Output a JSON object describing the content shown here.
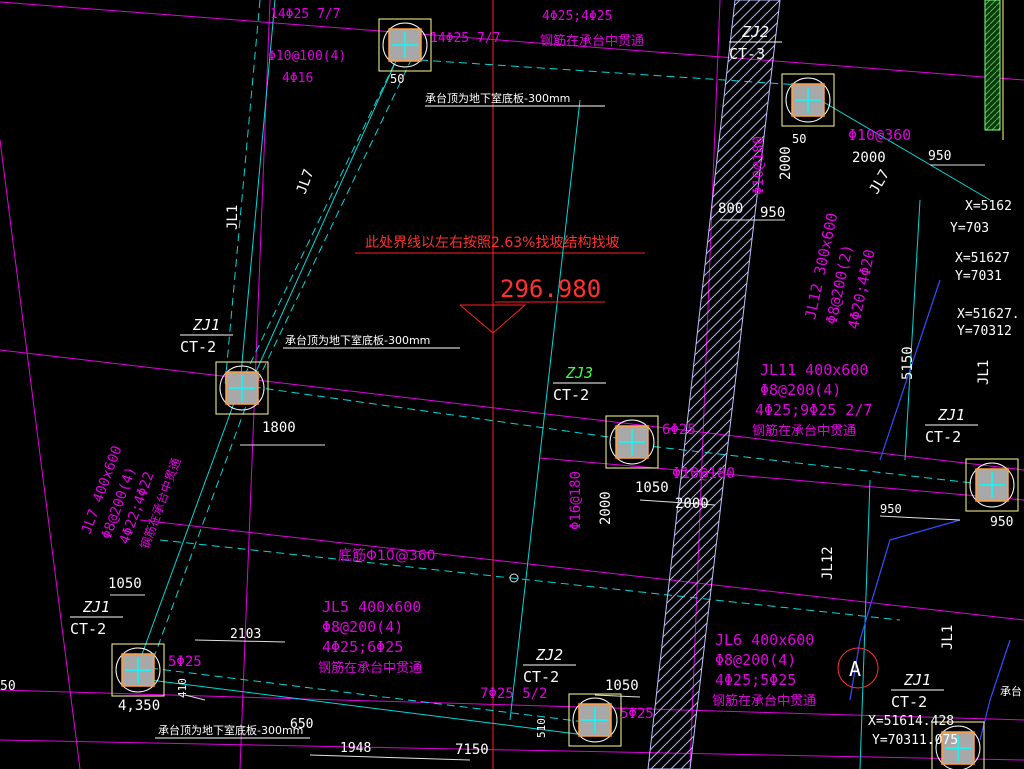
{
  "drawing": {
    "elevation_label": "296.980",
    "slope_note": "此处界线以左右按照2.63%找坡结构找坡",
    "base_rebar_note": "底筋Φ10@360",
    "piles": [
      {
        "id": "zj1_top_left_label",
        "line1": "ZJ1",
        "line2": "CT-2"
      },
      {
        "id": "zj1_bottom_left_label",
        "line1": "ZJ1",
        "line2": "CT-2"
      },
      {
        "id": "zj3_label",
        "line1": "ZJ3",
        "line2": "CT-2"
      },
      {
        "id": "zj2_bottom_label",
        "line1": "ZJ2",
        "line2": "CT-2"
      },
      {
        "id": "zj2_top_right_label",
        "line1": "ZJ2",
        "line2": "CT-3"
      },
      {
        "id": "zj1_right_label",
        "line1": "ZJ1",
        "line2": "CT-2"
      },
      {
        "id": "zj1_far_right_label",
        "line1": "ZJ1",
        "line2": "CT-2"
      },
      {
        "id": "zj1_bottom_right_label",
        "line1": "ZJ1",
        "line2": "CT-2"
      }
    ],
    "notes": {
      "slab_top_1": "承台顶为地下室底板-300mm",
      "slab_top_2": "承台顶为地下室底板-300mm",
      "slab_top_3": "承台顶为地下室底板-300mm",
      "jl5_1": "JL5 400x600",
      "jl5_2": "Φ8@200(4)",
      "jl5_3": "4Φ25;6Φ25",
      "jl5_4": "钢筋在承台中贯通",
      "jl6_1": "JL6 400x600",
      "jl6_2": "Φ8@200(4)",
      "jl6_3": "4Φ25;5Φ25",
      "jl6_4": "钢筋在承台中贯通",
      "jl11_1": "JL11 400x600",
      "jl11_2": "Φ8@200(4)",
      "jl11_3": "4Φ25;9Φ25 2/7",
      "jl11_4": "钢筋在承台中贯通",
      "jl12_1": "JL12 300x600",
      "jl12_2": "Φ8@200(2)",
      "jl12_3": "4Φ20;4Φ20",
      "jl7_1": "JL7 400x600",
      "jl7_2": "Φ8@200(4)",
      "jl7_3": "4Φ22;4Φ22",
      "jl7_4": "钢筋在承台中贯通",
      "top_1": "14Φ25 7/7",
      "top_2": "14Φ25 7/7",
      "top_3": "4Φ25;4Φ25",
      "top_4": "钢筋在承台中贯通",
      "top_5": "Φ10@100(4)",
      "top_6": "4Φ16",
      "rebar_360": "Φ10@360",
      "rebar_180a": "Φ10@180",
      "rebar_180b": "Φ10@180",
      "rebar_180c": "Φ16@180",
      "rebar_6_25": "6Φ25",
      "rebar_5_25a": "5Φ25",
      "rebar_5_25b": "5Φ25",
      "rebar_7_25": "7Φ25 5/2",
      "axis_A": "A",
      "jl1": "JL1",
      "jl7v": "JL7",
      "jl12v": "JL12",
      "jl1r": "JL1",
      "jl7r": "JL7",
      "jl1br": "JL1",
      "jl12b": "JL12",
      "coord_1x": "X=51627",
      "coord_1y": "Y=7031",
      "coord_2x": "X=51627.",
      "coord_2y": "Y=70312",
      "coord_3x": "X=5162",
      "coord_3y": "Y=703",
      "coord_4x": "X=51614.428",
      "coord_4y": "Y=70311.075",
      "chengtai": "承台",
      "d_50a": "50",
      "d_50b": "50",
      "d_1800": "1800",
      "d_1050a": "1050",
      "d_1050b": "1050",
      "d_1050c": "1050",
      "d_2103": "2103",
      "d_4350": "4,350",
      "d_1948": "1948",
      "d_7150": "7150",
      "d_650": "650",
      "d_2000a": "2000",
      "d_2000b": "2000",
      "d_2000c": "2000",
      "d_2000d": "2000",
      "d_800": "800",
      "d_950a": "950",
      "d_950b": "950",
      "d_950c": "950",
      "d_950d": "950",
      "d_5150": "5150",
      "d_50left": "50",
      "d_410": "410",
      "d_510": "510"
    }
  },
  "colors": {
    "background": "#000000",
    "cyan": "#00ffff",
    "white": "#ffffff",
    "magenta": "#ff00ff",
    "red": "#ff2020",
    "green": "#40ff40",
    "yellow": "#ffff80",
    "blue": "#2040ff",
    "pile_fill": "#a0a0a0"
  }
}
